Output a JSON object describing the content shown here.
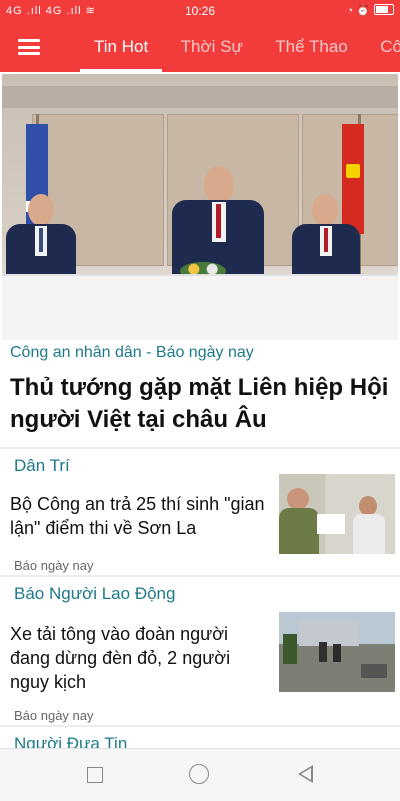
{
  "status_bar": {
    "left": "4G .ıll 4G .ıll ≋",
    "time": "10:26",
    "right": "◔ ⏰"
  },
  "toolbar": {
    "menu_icon": "hamburger-menu-icon",
    "tabs": [
      {
        "label": "Tin Hot",
        "active": true
      },
      {
        "label": "Thời Sự",
        "active": false
      },
      {
        "label": "Thể Thao",
        "active": false
      },
      {
        "label": "Côn",
        "active": false
      }
    ],
    "accent": "#f23b3b"
  },
  "hero": {
    "source": "Công an nhân dân - Báo ngày nay",
    "title": "Thủ tướng gặp mặt Liên hiệp Hội người Việt tại châu Âu"
  },
  "articles": [
    {
      "source": "Dân Trí",
      "title": "Bộ Công an trả 25 thí sinh \"gian lận\" điểm thi về Sơn La",
      "meta": "Báo ngày nay"
    },
    {
      "source": "Báo Người Lao Động",
      "title": "Xe tải tông vào đoàn người đang dừng đèn đỏ, 2 người nguy kịch",
      "meta": "Báo ngày nay"
    },
    {
      "source": "Người Đưa Tin"
    }
  ],
  "nav_bar": {
    "icons": [
      "recent-apps-icon",
      "home-icon",
      "back-icon"
    ]
  },
  "colors": {
    "source_text": "#1e7a8a",
    "title_text": "#111111"
  }
}
